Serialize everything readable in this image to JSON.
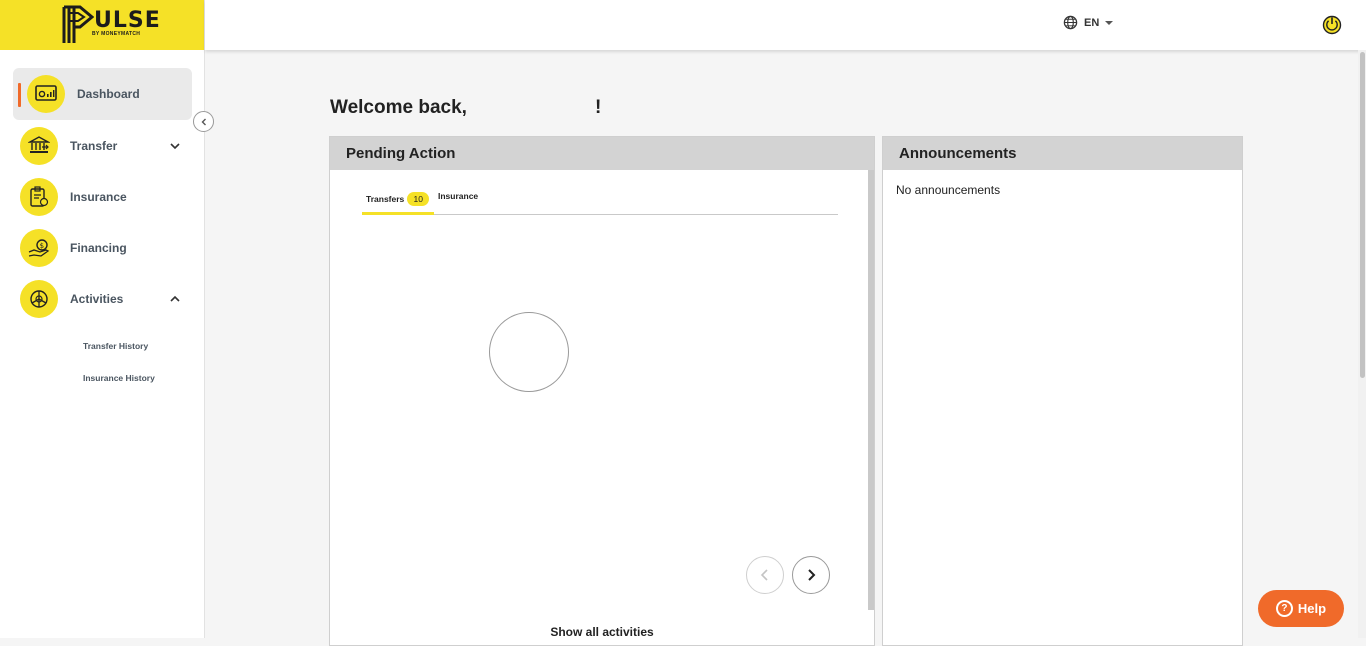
{
  "brand": {
    "name": "ULSE",
    "tagline": "BY MONEYMATCH",
    "logo_color": "#f5e127",
    "accent_color": "#f06a2a"
  },
  "sidebar": {
    "items": [
      {
        "label": "Dashboard",
        "icon": "dashboard-icon",
        "active": true
      },
      {
        "label": "Transfer",
        "icon": "bank-icon",
        "expandable": true,
        "expanded": false
      },
      {
        "label": "Insurance",
        "icon": "insurance-icon"
      },
      {
        "label": "Financing",
        "icon": "financing-icon"
      },
      {
        "label": "Activities",
        "icon": "activities-icon",
        "expandable": true,
        "expanded": true
      }
    ],
    "sub_items": [
      {
        "label": "Transfer History"
      },
      {
        "label": "Insurance History"
      }
    ]
  },
  "topbar": {
    "language": "EN"
  },
  "main": {
    "welcome": "Welcome back,",
    "welcome_suffix": "!",
    "pending": {
      "title": "Pending Action",
      "tabs": [
        {
          "label": "Transfers",
          "count": "10",
          "active": true
        },
        {
          "label": "Insurance",
          "active": false
        }
      ],
      "show_all": "Show all activities"
    },
    "announcements": {
      "title": "Announcements",
      "empty_text": "No announcements"
    }
  },
  "help": {
    "label": "Help"
  }
}
